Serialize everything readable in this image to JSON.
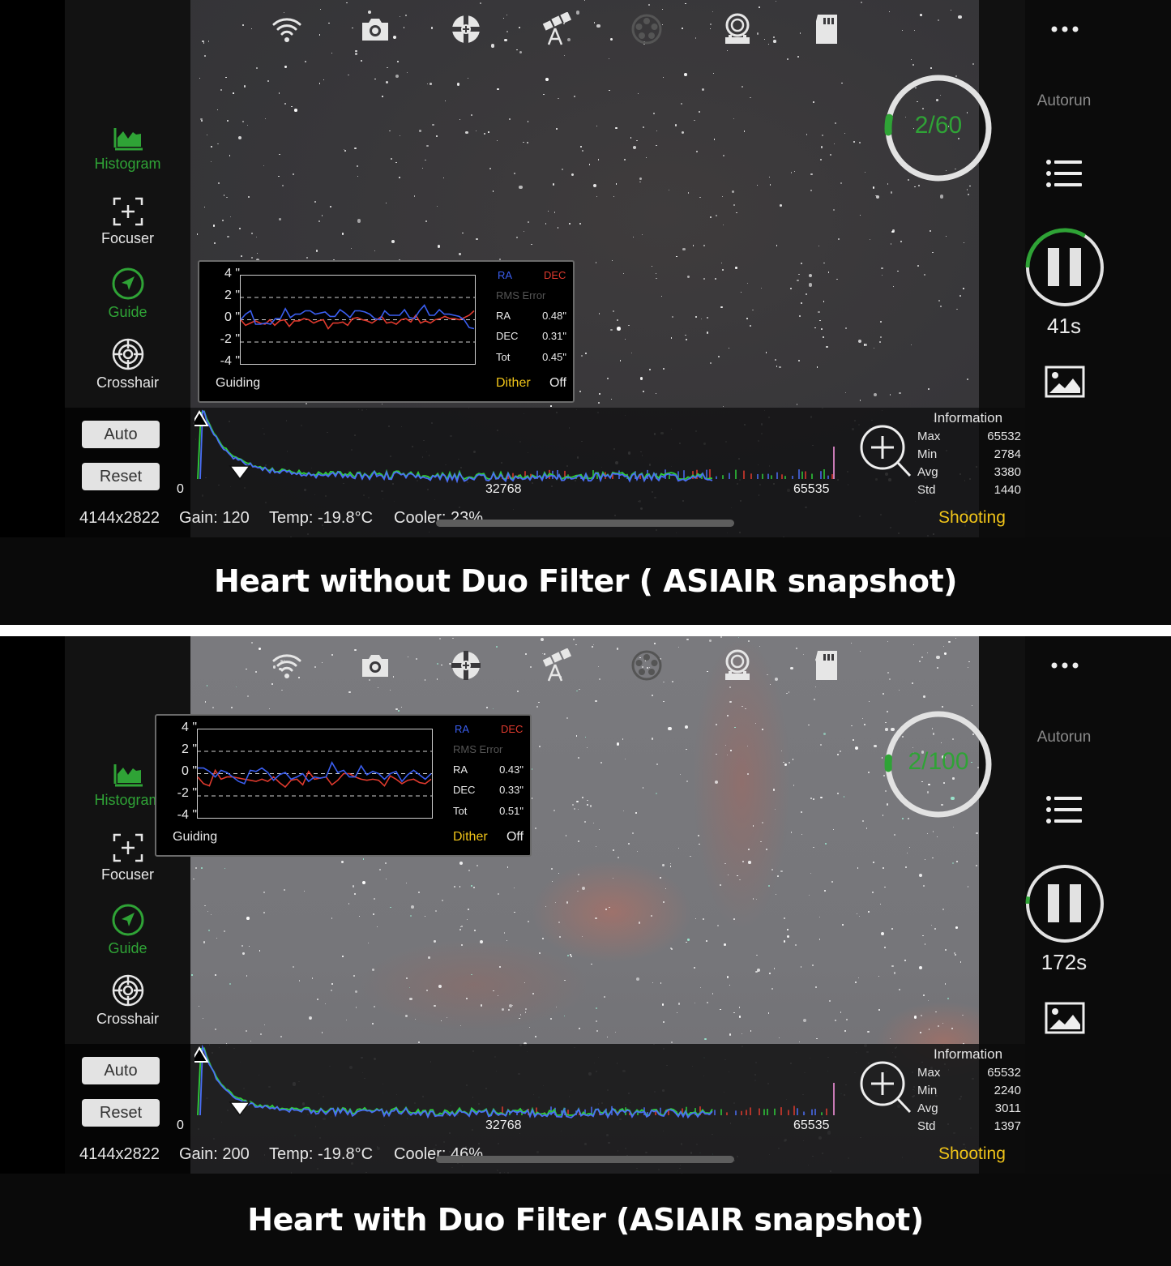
{
  "captions": [
    "Heart without Duo Filter ( ASIAIR snapshot)",
    "Heart with Duo Filter (ASIAIR snapshot)"
  ],
  "colors": {
    "accent_green": "#2fa336",
    "ra_blue": "#3a5ef0",
    "dec_red": "#e03a2e",
    "status_yellow": "#f0c419"
  },
  "top_icons": [
    "wifi-icon",
    "camera-icon",
    "guide-scope-icon",
    "telescope-mount-icon",
    "filter-wheel-icon",
    "focuser-motor-icon",
    "sd-card-icon"
  ],
  "sidebar": {
    "items": [
      {
        "label": "Histogram",
        "icon": "histogram-icon",
        "active": true
      },
      {
        "label": "Focuser",
        "icon": "focus-frame-icon",
        "active": false
      },
      {
        "label": "Guide",
        "icon": "guide-arrow-icon",
        "active": true
      },
      {
        "label": "Crosshair",
        "icon": "crosshair-icon",
        "active": false
      }
    ]
  },
  "right_sidebar": {
    "more_icon": "ellipsis-icon",
    "autorun_label": "Autorun",
    "list_icon": "list-icon",
    "pause_icon": "pause-icon",
    "gallery_icon": "image-gallery-icon"
  },
  "histogram": {
    "auto_label": "Auto",
    "reset_label": "Reset",
    "ticks": [
      "0",
      "32768",
      "65535"
    ],
    "info_title": "Information",
    "info_labels": [
      "Max",
      "Min",
      "Avg",
      "Std"
    ],
    "status": "Shooting"
  },
  "guiding": {
    "y_labels": [
      "4 \"",
      "2 \"",
      "0 \"",
      "-2 \"",
      "-4 \""
    ],
    "legend_ra": "RA",
    "legend_dec": "DEC",
    "rms_label": "RMS Error",
    "stat_labels": [
      "RA",
      "DEC",
      "Tot"
    ],
    "title": "Guiding",
    "dither_label": "Dither",
    "dither_value": "Off"
  },
  "panels": [
    {
      "progress": {
        "text": "2/60",
        "current": 2,
        "total": 60
      },
      "exposure": {
        "remaining": "41s",
        "fraction_elapsed": 0.34
      },
      "guiding": {
        "rms": [
          "0.48\"",
          "0.31\"",
          "0.45\""
        ],
        "ra_series": [
          0.0,
          0.5,
          0.8,
          -0.4,
          -0.4,
          -0.3,
          -0.4,
          0.1,
          0.1,
          1.0,
          0.2,
          0.5,
          0.5,
          0.8,
          0.8,
          0.5,
          0.6,
          0.7,
          0.3,
          0.3,
          0.9,
          0.6,
          0.2,
          0.8,
          0.8,
          0.7,
          0.5,
          0.1,
          0.0,
          0.8,
          0.4,
          0.4,
          0.4,
          0.9,
          0.2,
          0.1,
          0.8,
          1.3,
          0.4,
          0.4,
          0.9,
          0.5,
          0.5,
          0.4,
          0.3,
          0.0,
          -0.7,
          -0.8
        ],
        "dec_series": [
          0.0,
          -0.5,
          -0.3,
          -0.1,
          -0.3,
          -0.4,
          0.0,
          -0.5,
          -0.1,
          0.0,
          -0.6,
          -0.1,
          -0.1,
          0.1,
          0.0,
          -0.3,
          -0.1,
          0.0,
          -0.8,
          -0.3,
          -0.3,
          -0.2,
          -0.5,
          0.1,
          0.2,
          0.0,
          -0.1,
          -0.3,
          0.0,
          0.3,
          -0.3,
          -0.2,
          -0.4,
          0.0,
          0.1,
          -0.2,
          0.4,
          -0.3,
          -0.1,
          -0.3,
          0.0,
          0.1,
          0.3,
          0.1,
          0.1,
          0.0,
          0.2,
          0.4,
          0.8
        ]
      },
      "histogram": {
        "info_values": [
          "65532",
          "2784",
          "3380",
          "1440"
        ]
      },
      "status_line": [
        "4144x2822",
        "Gain: 120",
        "Temp: -19.8°C",
        "Cooler: 23%"
      ]
    },
    {
      "progress": {
        "text": "2/100",
        "current": 2,
        "total": 100
      },
      "exposure": {
        "remaining": "172s",
        "fraction_elapsed": 0.03
      },
      "guiding": {
        "rms": [
          "0.43\"",
          "0.33\"",
          "0.51\""
        ],
        "ra_series": [
          0.5,
          0.5,
          0.2,
          -0.3,
          0.3,
          0.1,
          -0.3,
          -0.7,
          -0.9,
          0.3,
          0.2,
          0.5,
          0.1,
          -0.6,
          -0.1,
          0.1,
          -0.5,
          -0.3,
          0.0,
          -0.7,
          -0.3,
          -0.4,
          -0.3,
          1.0,
          0.1,
          0.3,
          -0.3,
          -0.3,
          0.7,
          -0.1,
          0.2,
          0.0,
          -0.5,
          0.0,
          0.2,
          -0.7,
          -0.1,
          0.3,
          -0.1,
          -0.5,
          0.0
        ],
        "dec_series": [
          -0.3,
          -0.9,
          -1.1,
          0.3,
          -0.5,
          -0.3,
          -0.3,
          -0.4,
          -0.5,
          -0.6,
          -0.7,
          -0.5,
          -0.7,
          -0.3,
          -0.8,
          -1.2,
          -0.6,
          -0.5,
          -1.0,
          0.2,
          -0.5,
          -0.4,
          -0.3,
          -1.0,
          -0.6,
          0.0,
          0.0,
          -0.3,
          -0.5,
          -0.6,
          -0.5,
          -0.6,
          -1.1,
          -0.2,
          -0.5,
          -0.9,
          -0.6,
          -0.5,
          -0.8,
          -0.9,
          -0.5
        ]
      },
      "histogram": {
        "info_values": [
          "65532",
          "2240",
          "3011",
          "1397"
        ]
      },
      "status_line": [
        "4144x2822",
        "Gain: 200",
        "Temp: -19.8°C",
        "Cooler: 46%"
      ]
    }
  ]
}
